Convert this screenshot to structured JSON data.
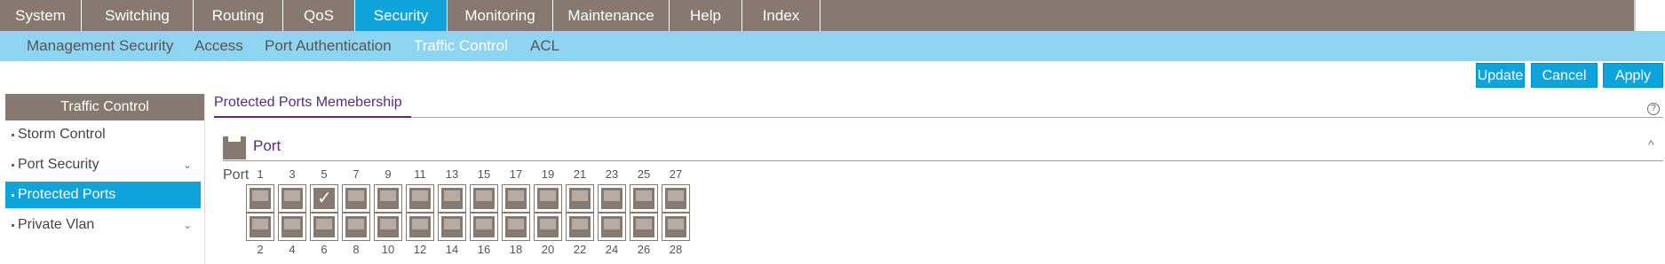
{
  "top_nav": {
    "tabs": [
      {
        "label": "System",
        "active": false
      },
      {
        "label": "Switching",
        "active": false
      },
      {
        "label": "Routing",
        "active": false
      },
      {
        "label": "QoS",
        "active": false
      },
      {
        "label": "Security",
        "active": true
      },
      {
        "label": "Monitoring",
        "active": false
      },
      {
        "label": "Maintenance",
        "active": false
      },
      {
        "label": "Help",
        "active": false
      },
      {
        "label": "Index",
        "active": false
      }
    ]
  },
  "sub_nav": {
    "items": [
      {
        "label": "Management Security",
        "active": false
      },
      {
        "label": "Access",
        "active": false
      },
      {
        "label": "Port Authentication",
        "active": false
      },
      {
        "label": "Traffic Control",
        "active": true
      },
      {
        "label": "ACL",
        "active": false
      }
    ]
  },
  "actions": {
    "update": "Update",
    "cancel": "Cancel",
    "apply": "Apply"
  },
  "sidebar": {
    "title": "Traffic Control",
    "items": [
      {
        "label": "Storm Control",
        "active": false,
        "expandable": false
      },
      {
        "label": "Port Security",
        "active": false,
        "expandable": true
      },
      {
        "label": "Protected Ports",
        "active": true,
        "expandable": false
      },
      {
        "label": "Private Vlan",
        "active": false,
        "expandable": true
      }
    ]
  },
  "content": {
    "title": "Protected Ports Memebership",
    "help_icon": "?",
    "section": {
      "title": "Port",
      "collapse_icon": "^",
      "row_label": "Port",
      "top_ports": [
        "1",
        "3",
        "5",
        "7",
        "9",
        "11",
        "13",
        "15",
        "17",
        "19",
        "21",
        "23",
        "25",
        "27"
      ],
      "bottom_ports": [
        "2",
        "4",
        "6",
        "8",
        "10",
        "12",
        "14",
        "16",
        "18",
        "20",
        "22",
        "24",
        "26",
        "28"
      ],
      "checked_ports": [
        "5"
      ]
    }
  },
  "colors": {
    "nav_bg": "#857970",
    "accent": "#0fa3dc",
    "subnav_bg": "#8fd5f2",
    "title_purple": "#5b2a86"
  }
}
